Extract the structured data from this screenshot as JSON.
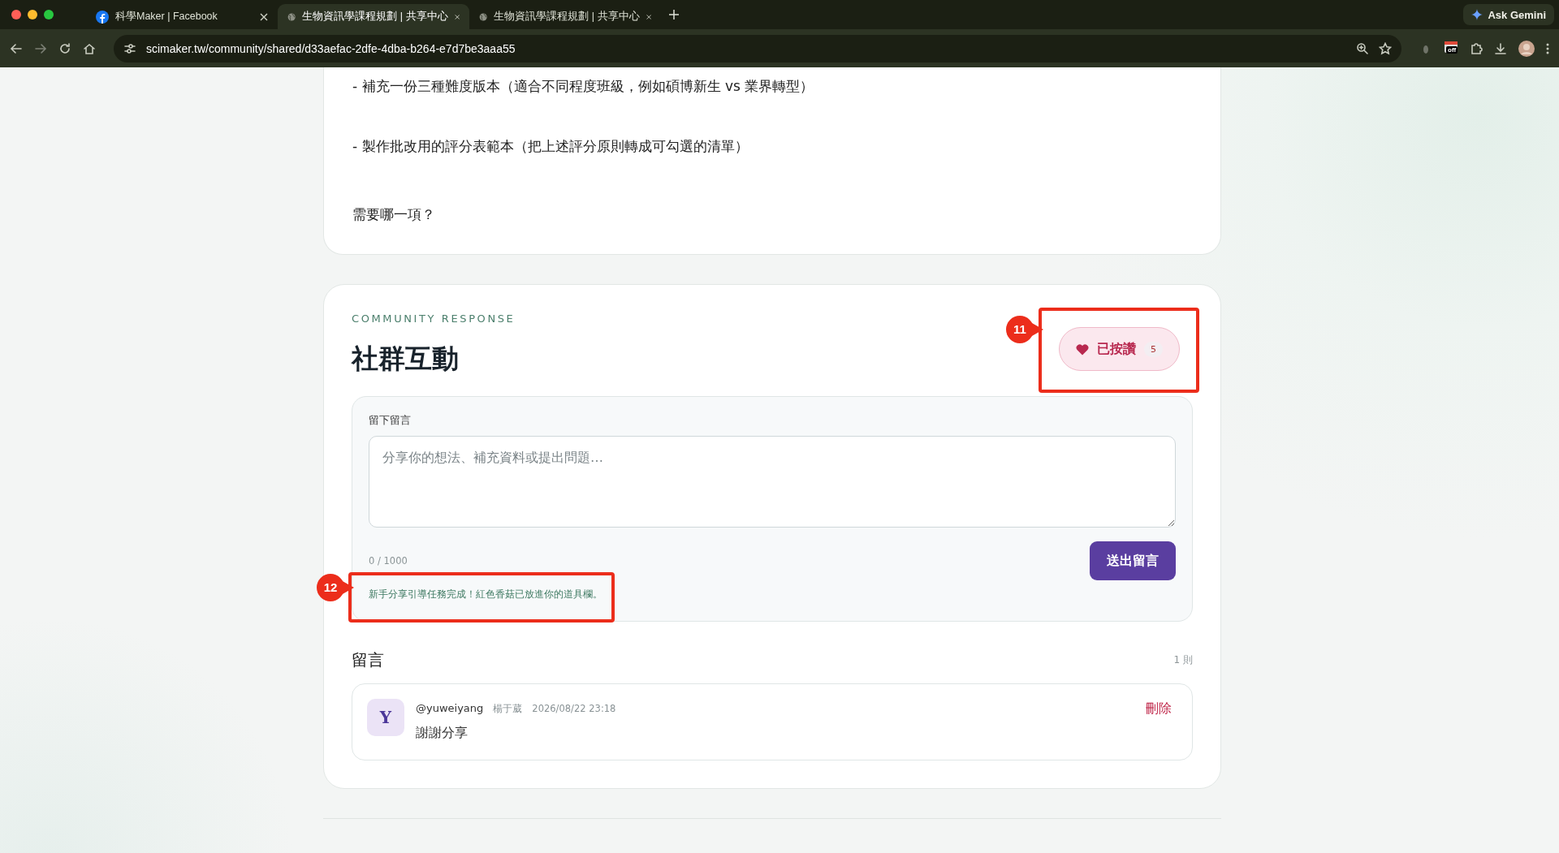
{
  "browser": {
    "tabs": [
      {
        "title": "科學Maker | Facebook",
        "kind": "facebook",
        "selected": false
      },
      {
        "title": "生物資訊學課程規劃 | 共享中心",
        "kind": "web",
        "selected": true
      },
      {
        "title": "生物資訊學課程規劃 | 共享中心",
        "kind": "web",
        "selected": false
      }
    ],
    "address": "scimaker.tw/community/shared/d33aefac-2dfe-4dba-b264-e7d7be3aaa55",
    "ask_button": "Ask Gemini",
    "extension_badge": "off"
  },
  "post": {
    "paragraphs": [
      "- 補充一份三種難度版本（適合不同程度班級，例如碩博新生 vs 業界轉型）",
      "- 製作批改用的評分表範本（把上述評分原則轉成可勾選的清單）",
      "需要哪一項？"
    ]
  },
  "community": {
    "eyebrow": "COMMUNITY RESPONSE",
    "title": "社群互動",
    "like": {
      "label": "已按讚",
      "count": "5",
      "liked": true
    },
    "form": {
      "label": "留下留言",
      "placeholder": "分享你的想法、補充資料或提出問題…",
      "counter": "0 / 1000",
      "submit": "送出留言",
      "notice": "新手分享引導任務完成！紅色香菇已放進你的道具欄。"
    },
    "comments_heading": "留言",
    "comments_count": "1 則",
    "comments": [
      {
        "avatar": "Y",
        "handle": "@yuweiyang",
        "name": "楊于葳",
        "time": "2026/08/22 23:18",
        "body": "謝謝分享",
        "delete": "刪除"
      }
    ]
  },
  "callouts": [
    {
      "number": "11"
    },
    {
      "number": "12"
    }
  ]
}
